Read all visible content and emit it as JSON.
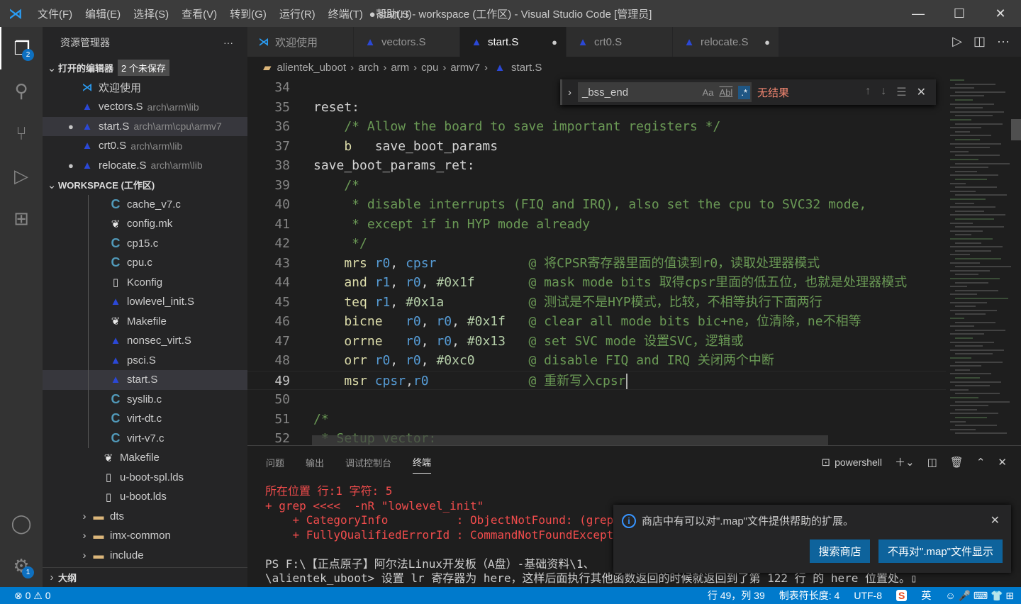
{
  "window": {
    "title": "● start.S - workspace (工作区) - Visual Studio Code [管理员]",
    "menu": [
      "文件(F)",
      "编辑(E)",
      "选择(S)",
      "查看(V)",
      "转到(G)",
      "运行(R)",
      "终端(T)",
      "帮助(H)"
    ]
  },
  "activity": {
    "explorer_badge": "2",
    "settings_badge": "1"
  },
  "sidebar": {
    "title": "资源管理器",
    "more": "···",
    "open_editors": {
      "label": "打开的编辑器",
      "badge": "2 个未保存",
      "items": [
        {
          "name": "欢迎使用",
          "desc": "",
          "icon": "vscode",
          "dirty": false
        },
        {
          "name": "vectors.S",
          "desc": "arch\\arm\\lib",
          "icon": "asm",
          "dirty": false
        },
        {
          "name": "start.S",
          "desc": "arch\\arm\\cpu\\armv7",
          "icon": "asm",
          "dirty": true,
          "selected": true
        },
        {
          "name": "crt0.S",
          "desc": "arch\\arm\\lib",
          "icon": "asm",
          "dirty": false
        },
        {
          "name": "relocate.S",
          "desc": "arch\\arm\\lib",
          "icon": "asm",
          "dirty": true
        }
      ]
    },
    "workspace": {
      "label": "WORKSPACE (工作区)",
      "items": [
        {
          "name": "cache_v7.c",
          "icon": "c",
          "indent": 2
        },
        {
          "name": "config.mk",
          "icon": "make",
          "indent": 2
        },
        {
          "name": "cp15.c",
          "icon": "c",
          "indent": 2
        },
        {
          "name": "cpu.c",
          "icon": "c",
          "indent": 2
        },
        {
          "name": "Kconfig",
          "icon": "file",
          "indent": 2
        },
        {
          "name": "lowlevel_init.S",
          "icon": "asm",
          "indent": 2
        },
        {
          "name": "Makefile",
          "icon": "make",
          "indent": 2
        },
        {
          "name": "nonsec_virt.S",
          "icon": "asm",
          "indent": 2
        },
        {
          "name": "psci.S",
          "icon": "asm",
          "indent": 2
        },
        {
          "name": "start.S",
          "icon": "asm",
          "indent": 2,
          "selected": true
        },
        {
          "name": "syslib.c",
          "icon": "c",
          "indent": 2
        },
        {
          "name": "virt-dt.c",
          "icon": "c",
          "indent": 2
        },
        {
          "name": "virt-v7.c",
          "icon": "c",
          "indent": 2
        },
        {
          "name": "Makefile",
          "icon": "make",
          "indent": 1
        },
        {
          "name": "u-boot-spl.lds",
          "icon": "file",
          "indent": 1
        },
        {
          "name": "u-boot.lds",
          "icon": "file",
          "indent": 1
        },
        {
          "name": "dts",
          "icon": "folder",
          "indent": 1,
          "folder": true
        },
        {
          "name": "imx-common",
          "icon": "folder",
          "indent": 1,
          "folder": true
        },
        {
          "name": "include",
          "icon": "folder",
          "indent": 1,
          "folder": true
        }
      ]
    },
    "outline": "大纲"
  },
  "tabs": [
    {
      "label": "欢迎使用",
      "icon": "vscode",
      "dirty": false
    },
    {
      "label": "vectors.S",
      "icon": "asm",
      "dirty": false
    },
    {
      "label": "start.S",
      "icon": "asm",
      "dirty": true,
      "active": true
    },
    {
      "label": "crt0.S",
      "icon": "asm",
      "dirty": false
    },
    {
      "label": "relocate.S",
      "icon": "asm",
      "dirty": true
    }
  ],
  "breadcrumb": [
    "alientek_uboot",
    "arch",
    "arm",
    "cpu",
    "armv7",
    "start.S"
  ],
  "find": {
    "value": "_bss_end",
    "match_case": "Aa",
    "whole_word": "Abl",
    "regex": ".*",
    "result": "无结果"
  },
  "code": {
    "current_line": 49,
    "lines": [
      {
        "n": 34,
        "t": []
      },
      {
        "n": 35,
        "t": [
          [
            "lbl",
            "reset:"
          ]
        ]
      },
      {
        "n": 36,
        "t": [
          [
            "cmt",
            "    /* Allow the board to save important registers */"
          ]
        ]
      },
      {
        "n": 37,
        "t": [
          [
            "kw",
            "    b   "
          ],
          [
            "lbl",
            "save_boot_params"
          ]
        ]
      },
      {
        "n": 38,
        "t": [
          [
            "lbl",
            "save_boot_params_ret:"
          ]
        ]
      },
      {
        "n": 39,
        "t": [
          [
            "cmt",
            "    /*"
          ]
        ]
      },
      {
        "n": 40,
        "t": [
          [
            "cmt",
            "     * disable interrupts (FIQ and IRQ), also set the cpu to SVC32 mode,"
          ]
        ]
      },
      {
        "n": 41,
        "t": [
          [
            "cmt",
            "     * except if in HYP mode already"
          ]
        ]
      },
      {
        "n": 42,
        "t": [
          [
            "cmt",
            "     */"
          ]
        ]
      },
      {
        "n": 43,
        "t": [
          [
            "kw",
            "    mrs "
          ],
          [
            "reg",
            "r0"
          ],
          [
            "lbl",
            ", "
          ],
          [
            "reg",
            "cpsr"
          ],
          [
            "lbl",
            "            "
          ],
          [
            "cmt",
            "@ 将CPSR寄存器里面的值读到r0，读取处理器模式"
          ]
        ]
      },
      {
        "n": 44,
        "t": [
          [
            "kw",
            "    and "
          ],
          [
            "reg",
            "r1"
          ],
          [
            "lbl",
            ", "
          ],
          [
            "reg",
            "r0"
          ],
          [
            "lbl",
            ", "
          ],
          [
            "num",
            "#0x1f"
          ],
          [
            "lbl",
            "       "
          ],
          [
            "cmt",
            "@ mask mode bits 取得cpsr里面的低五位，也就是处理器模式"
          ]
        ]
      },
      {
        "n": 45,
        "t": [
          [
            "kw",
            "    teq "
          ],
          [
            "reg",
            "r1"
          ],
          [
            "lbl",
            ", "
          ],
          [
            "num",
            "#0x1a"
          ],
          [
            "lbl",
            "           "
          ],
          [
            "cmt",
            "@ 测试是不是HYP模式，比较，不相等执行下面两行"
          ]
        ]
      },
      {
        "n": 46,
        "t": [
          [
            "kw",
            "    bicne   "
          ],
          [
            "reg",
            "r0"
          ],
          [
            "lbl",
            ", "
          ],
          [
            "reg",
            "r0"
          ],
          [
            "lbl",
            ", "
          ],
          [
            "num",
            "#0x1f"
          ],
          [
            "lbl",
            "   "
          ],
          [
            "cmt",
            "@ clear all mode bits bic+ne，位清除，ne不相等"
          ]
        ]
      },
      {
        "n": 47,
        "t": [
          [
            "kw",
            "    orrne   "
          ],
          [
            "reg",
            "r0"
          ],
          [
            "lbl",
            ", "
          ],
          [
            "reg",
            "r0"
          ],
          [
            "lbl",
            ", "
          ],
          [
            "num",
            "#0x13"
          ],
          [
            "lbl",
            "   "
          ],
          [
            "cmt",
            "@ set SVC mode 设置SVC，逻辑或"
          ]
        ]
      },
      {
        "n": 48,
        "t": [
          [
            "kw",
            "    orr "
          ],
          [
            "reg",
            "r0"
          ],
          [
            "lbl",
            ", "
          ],
          [
            "reg",
            "r0"
          ],
          [
            "lbl",
            ", "
          ],
          [
            "num",
            "#0xc0"
          ],
          [
            "lbl",
            "       "
          ],
          [
            "cmt",
            "@ disable FIQ and IRQ 关闭两个中断"
          ]
        ]
      },
      {
        "n": 49,
        "t": [
          [
            "kw",
            "    msr "
          ],
          [
            "reg",
            "cpsr"
          ],
          [
            "lbl",
            ","
          ],
          [
            "reg",
            "r0"
          ],
          [
            "lbl",
            "             "
          ],
          [
            "cmt",
            "@ 重新写入cpsr"
          ]
        ]
      },
      {
        "n": 50,
        "t": []
      },
      {
        "n": 51,
        "t": [
          [
            "cmt",
            "/*"
          ]
        ]
      },
      {
        "n": 52,
        "t": [
          [
            "cmt",
            " * Setup vector:"
          ]
        ]
      }
    ]
  },
  "panel": {
    "tabs": [
      "问题",
      "输出",
      "调试控制台",
      "终端"
    ],
    "active_tab": "终端",
    "shell": "powershell",
    "terminal": [
      {
        "c": "err",
        "t": "所在位置 行:1 字符: 5"
      },
      {
        "c": "err",
        "t": "+ grep <<<<  -nR \"lowlevel_init\""
      },
      {
        "c": "err",
        "t": "    + CategoryInfo          : ObjectNotFound: (grep:String) [], CommandNotFoundException"
      },
      {
        "c": "err",
        "t": "    + FullyQualifiedErrorId : CommandNotFoundException"
      },
      {
        "c": "",
        "t": ""
      },
      {
        "c": "",
        "t": "PS F:\\【正点原子】阿尔法Linux开发板（A盘）-基础资料\\1、"
      },
      {
        "c": "",
        "t": "\\alientek_uboot> 设置 lr 寄存器为 here，这样后面执行其他函数返回的时候就返回到了第 122 行 的 here 位置处。▯"
      }
    ]
  },
  "notification": {
    "message": "商店中有可以对\".map\"文件提供帮助的扩展。",
    "buttons": [
      "搜索商店",
      "不再对\".map\"文件显示"
    ]
  },
  "status": {
    "errors": "0",
    "warnings": "0",
    "position": "行 49，列 39",
    "tab_size": "制表符长度: 4",
    "encoding": "UTF-8",
    "ime": "英"
  },
  "colors": {
    "accent": "#007acc",
    "error_text": "#f14c4c",
    "comment": "#6a9955",
    "register": "#569cd6",
    "mnemonic": "#dcdcaa",
    "number": "#b5cea8"
  }
}
